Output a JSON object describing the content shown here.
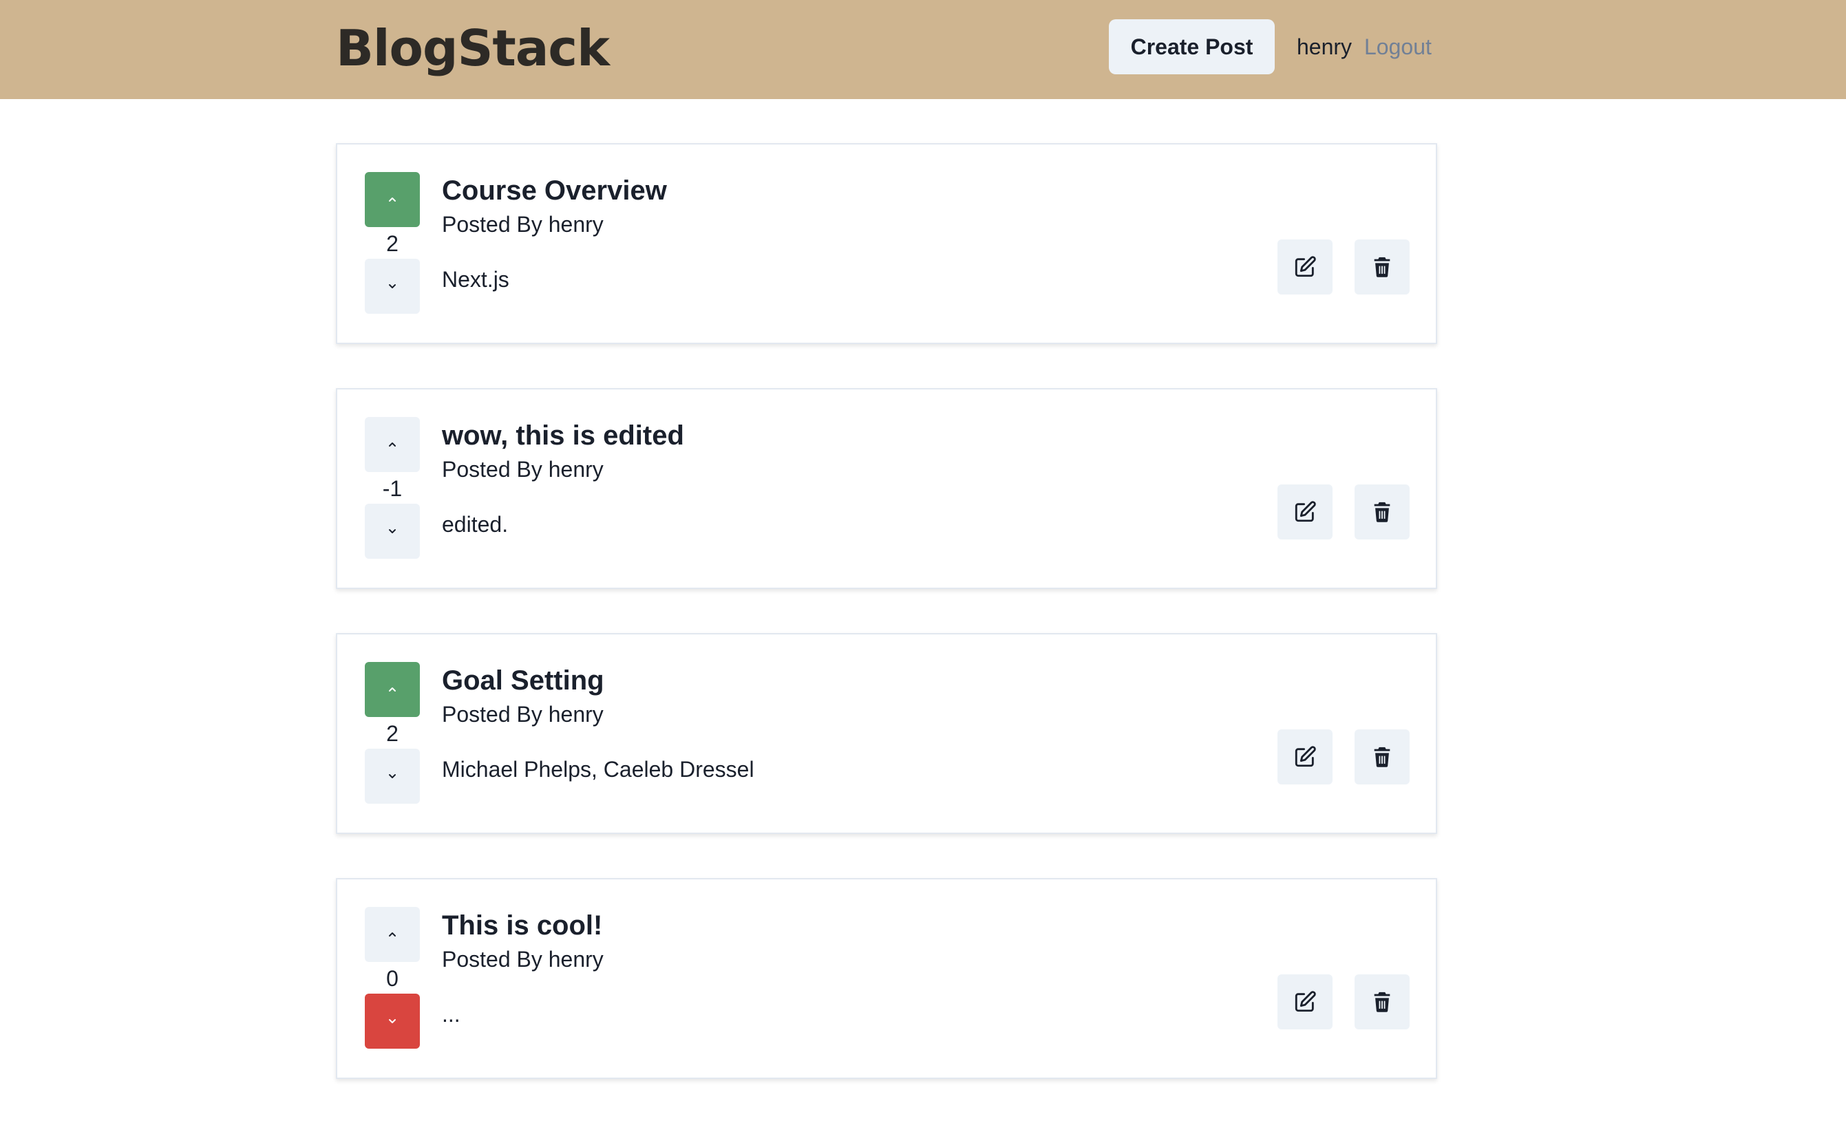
{
  "header": {
    "logo": "BlogStack",
    "create_post_label": "Create Post",
    "username": "henry",
    "logout_label": "Logout",
    "background_color": "#cfb590"
  },
  "posts": [
    {
      "title": "Course Overview",
      "author": "Posted By henry",
      "body": "Next.js",
      "votes": "2",
      "vote_state": "up"
    },
    {
      "title": "wow, this is edited",
      "author": "Posted By henry",
      "body": "edited.",
      "votes": "-1",
      "vote_state": "none"
    },
    {
      "title": "Goal Setting",
      "author": "Posted By henry",
      "body": "Michael Phelps, Caeleb Dressel",
      "votes": "2",
      "vote_state": "up"
    },
    {
      "title": "This is cool!",
      "author": "Posted By henry",
      "body": "...",
      "votes": "0",
      "vote_state": "down"
    }
  ],
  "icons": {
    "upvote": "chevron-up-icon",
    "downvote": "chevron-down-icon",
    "edit": "edit-icon",
    "delete": "trash-icon"
  },
  "colors": {
    "upvoted": "#58a06b",
    "downvoted": "#d9453f",
    "neutral_button": "#edf2f7",
    "logout_link": "#718096"
  }
}
